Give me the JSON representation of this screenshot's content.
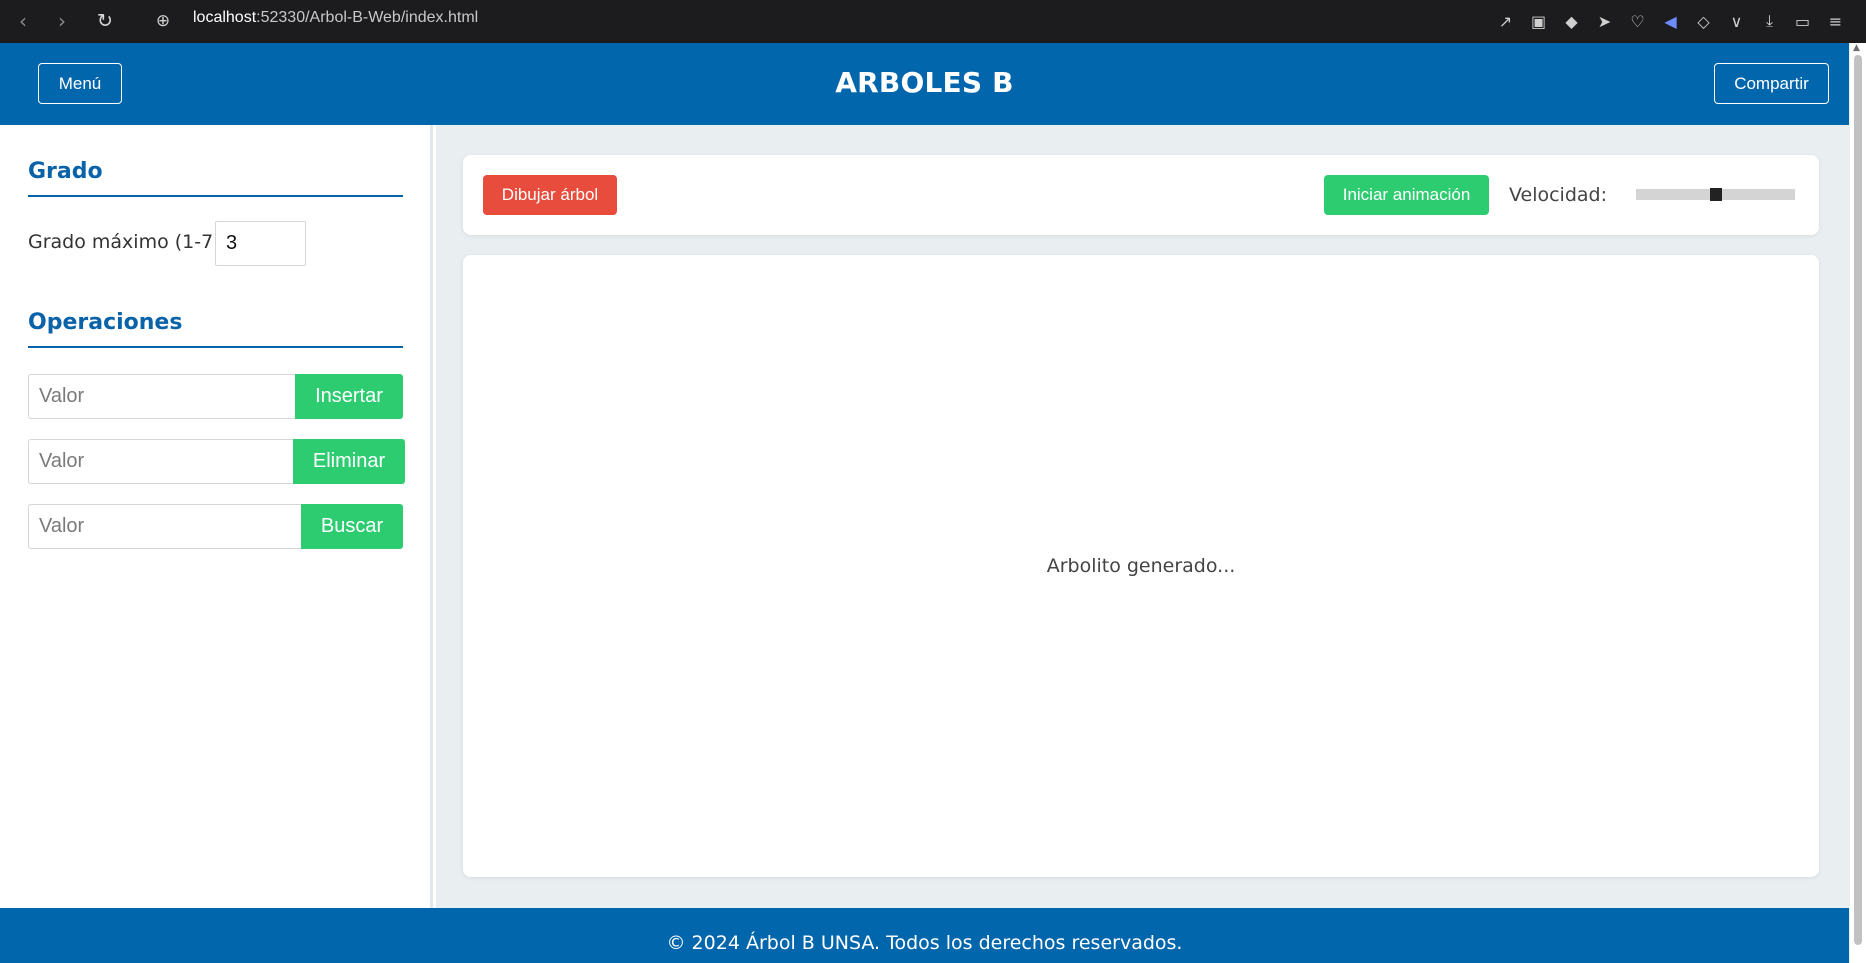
{
  "browser": {
    "url_host": "localhost",
    "url_rest": ":52330/Arbol-B-Web/index.html",
    "icons": [
      "back-icon",
      "forward-icon",
      "reload-icon",
      "site-info-icon",
      "share-page-icon",
      "screenshot-icon",
      "shield-icon",
      "send-icon",
      "heart-icon",
      "speaker-icon",
      "box-icon",
      "wallet-icon",
      "download-icon",
      "battery-icon",
      "settings-sliders-icon"
    ]
  },
  "header": {
    "menu_label": "Menú",
    "title": "ARBOLES B",
    "share_label": "Compartir",
    "background": "#0266ac"
  },
  "sidebar": {
    "grado": {
      "title": "Grado",
      "label": "Grado máximo (1-7):",
      "value": "3"
    },
    "operaciones": {
      "title": "Operaciones",
      "rows": [
        {
          "placeholder": "Valor",
          "button": "Insertar"
        },
        {
          "placeholder": "Valor",
          "button": "Eliminar"
        },
        {
          "placeholder": "Valor",
          "button": "Buscar"
        }
      ]
    }
  },
  "toolbar": {
    "draw_label": "Dibujar árbol",
    "animate_label": "Iniciar animación",
    "speed_label": "Velocidad:",
    "speed_value": 0.5,
    "draw_color": "#e74c3c",
    "action_color": "#2ecc71"
  },
  "canvas": {
    "message": "Arbolito generado..."
  },
  "footer": {
    "text": "© 2024 Árbol B UNSA. Todos los derechos reservados."
  }
}
